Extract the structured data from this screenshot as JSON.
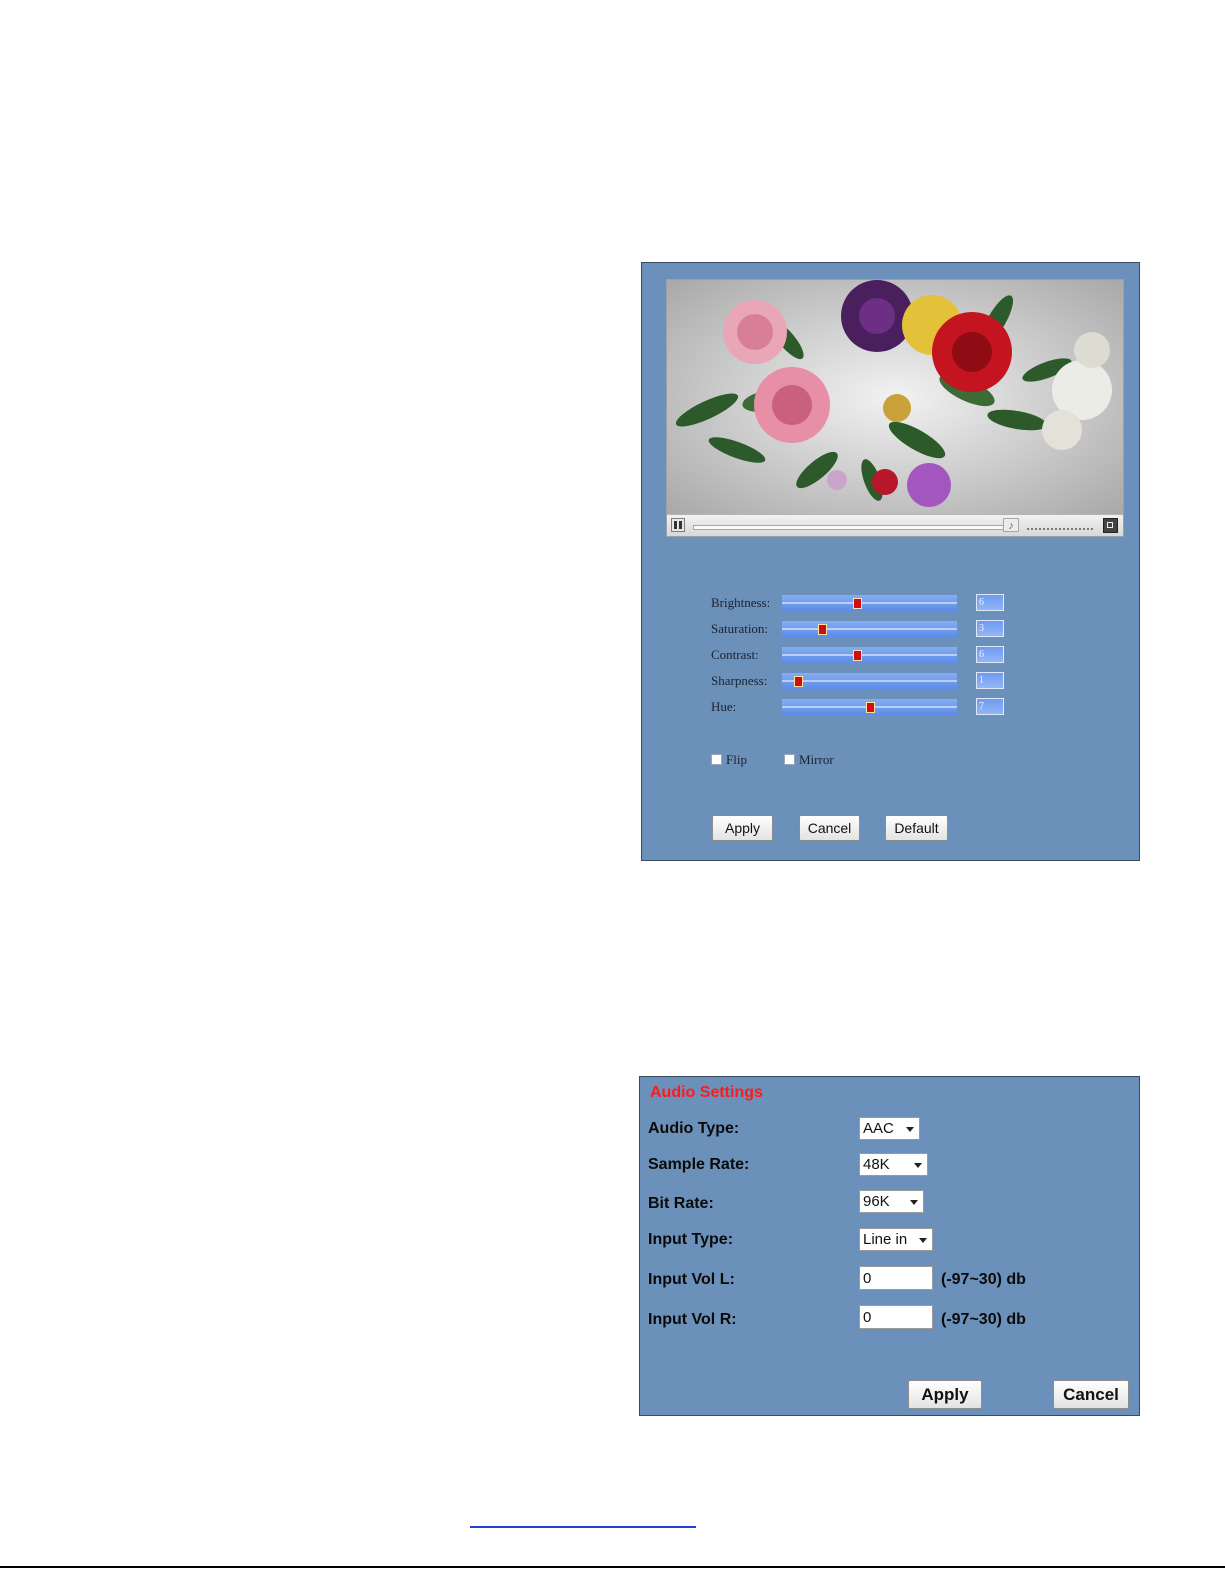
{
  "image_settings": {
    "sliders": [
      {
        "label": "Brightness:",
        "value": "6",
        "level": 0.43
      },
      {
        "label": "Saturation:",
        "value": "3",
        "level": 0.23
      },
      {
        "label": "Contrast:",
        "value": "6",
        "level": 0.43
      },
      {
        "label": "Sharpness:",
        "value": "1",
        "level": 0.09
      },
      {
        "label": "Hue:",
        "value": "7",
        "level": 0.5
      }
    ],
    "flip_label": "Flip",
    "mirror_label": "Mirror",
    "flip_checked": false,
    "mirror_checked": false,
    "buttons": {
      "apply": "Apply",
      "cancel": "Cancel",
      "default": "Default"
    }
  },
  "player": {
    "icons": [
      "pause-icon",
      "volume-icon",
      "fullscreen-icon"
    ]
  },
  "audio_settings": {
    "title": "Audio Settings",
    "audio_type": {
      "label": "Audio Type:",
      "value": "AAC"
    },
    "sample_rate": {
      "label": "Sample Rate:",
      "value": "48K"
    },
    "bit_rate": {
      "label": "Bit Rate:",
      "value": "96K"
    },
    "input_type": {
      "label": "Input Type:",
      "value": "Line in"
    },
    "input_vol_l": {
      "label": "Input Vol L:",
      "value": "0",
      "range": "(-97~30) db"
    },
    "input_vol_r": {
      "label": "Input Vol R:",
      "value": "0",
      "range": "(-97~30) db"
    },
    "buttons": {
      "apply": "Apply",
      "cancel": "Cancel"
    }
  },
  "colors": {
    "panel_bg": "#6b91ba",
    "title_red": "#ff1a1a",
    "slider_thumb": "#d10d0d"
  }
}
